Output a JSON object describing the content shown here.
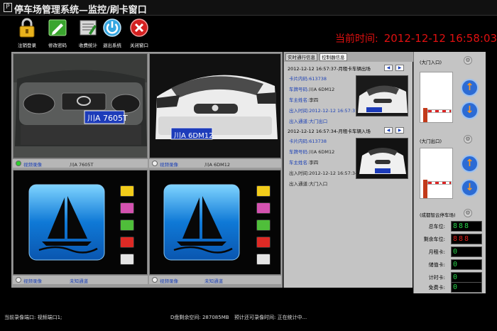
{
  "window": {
    "title": "停车场管理系统—监控/刷卡窗口",
    "icon": "P"
  },
  "toolbar": {
    "items": [
      {
        "label": "注销登录",
        "icon": "lock-icon"
      },
      {
        "label": "修改密码",
        "icon": "edit-password-icon"
      },
      {
        "label": "收费统计",
        "icon": "statistics-icon"
      },
      {
        "label": "退出系统",
        "icon": "power-icon"
      },
      {
        "label": "关闭窗口",
        "icon": "close-icon"
      }
    ],
    "time_label": "当前时间:",
    "time_value": "2012-12-12 16:58:03"
  },
  "video": {
    "panes": [
      {
        "status": "视频录像",
        "plate": "川A 7605T",
        "active": true
      },
      {
        "status": "视频录像",
        "plate": "川A 6DM12",
        "active": false
      },
      {
        "status": "视频录像",
        "plate": "未知通道",
        "active": false
      },
      {
        "status": "视频录像",
        "plate": "未知通道",
        "active": false
      }
    ],
    "plate_top_left": "川A 7605T",
    "plate_top_right": "川A 6DM12"
  },
  "info": {
    "tabs": [
      "实时通行信息",
      "控制器信息"
    ],
    "records": [
      {
        "head": "2012-12-12 16:57:37-月租卡车辆出场",
        "card": "卡片内码:613738",
        "plate_label": "车牌号码:",
        "plate": "川A 6DM12",
        "owner_label": "车主姓名:",
        "owner": "李四",
        "time": "出入时间:2012-12-12 16:57:37",
        "channel": "出入通道:大门出口"
      },
      {
        "head": "2012-12-12 16:57:34-月租卡车辆入场",
        "card": "卡片内码:613738",
        "plate_label": "车牌号码:",
        "plate": "川A 6DM12",
        "owner_label": "车主姓名:",
        "owner": "李四",
        "time": "出入时间:2012-12-12 16:57:34",
        "channel": "出入通道:大门入口"
      }
    ],
    "snap_plate": "川A 6DM12"
  },
  "gates": {
    "entry": "(大门入口)",
    "exit": "(大门出口)",
    "up": "↑",
    "down": "↓",
    "gear": "⚙"
  },
  "stats": {
    "title": "(成都智云停车场)",
    "rows": [
      {
        "label": "总车位:",
        "value": "888",
        "color": "#27d34a"
      },
      {
        "label": "剩余车位:",
        "value": "888",
        "color": "#e0211b"
      },
      {
        "label": "月租卡:",
        "value": "0",
        "color": "#27d34a"
      },
      {
        "label": "储值卡:",
        "value": "0",
        "color": "#27d34a"
      },
      {
        "label": "计时卡:",
        "value": "0",
        "color": "#27d34a"
      },
      {
        "label": "免费卡:",
        "value": "0",
        "color": "#27d34a"
      }
    ]
  },
  "status": {
    "left": "当前录像端口: 视频端口1;",
    "disk": "D盘剩余空间: 287085MB",
    "estimate": "预计还可录像时间: 正在统计中..."
  },
  "colors": {
    "time": "#e01010",
    "accent_blue": "#1a3fb5",
    "panel_bg": "#c4c4c4"
  }
}
